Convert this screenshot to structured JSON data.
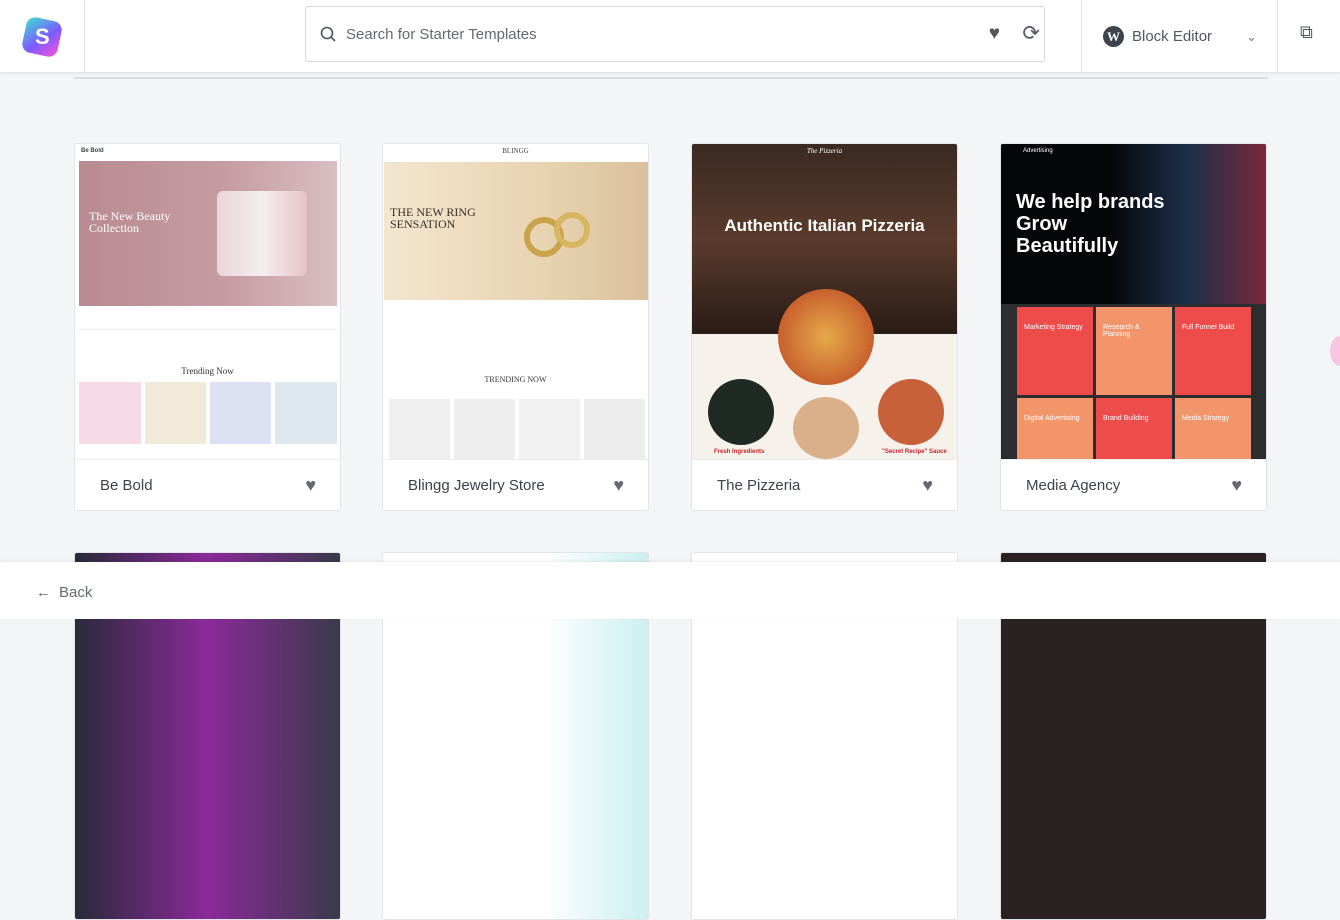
{
  "header": {
    "search_placeholder": "Search for Starter Templates",
    "editor_label": "Block Editor",
    "logo_letter": "S"
  },
  "icons": {
    "search": "search-icon",
    "favorite": "heart-icon",
    "sync": "sync-icon",
    "wordpress": "wordpress-icon",
    "chevron": "chevron-down-icon",
    "external": "external-link-icon",
    "back": "arrow-left-icon"
  },
  "templates": [
    {
      "name": "Be Bold",
      "brand": "Be Bold",
      "hero": "The New Beauty Collection",
      "section": "Trending Now"
    },
    {
      "name": "Blingg Jewelry Store",
      "brand": "BLINGG",
      "hero": "THE NEW RING SENSATION",
      "section": "TRENDING NOW"
    },
    {
      "name": "The Pizzeria",
      "brand": "The Pizzeria",
      "hero": "Authentic Italian Pizzeria",
      "captions": [
        "Fresh Ingredients",
        "\"Secret Recipe\" Sauce"
      ]
    },
    {
      "name": "Media Agency",
      "brand": "Advertising",
      "hero": "We help brands Grow Beautifully",
      "tiles": [
        "Marketing Strategy",
        "Research & Planning",
        "Full Funnel Build",
        "Digital Advertising",
        "Brand Building",
        "Media Strategy"
      ]
    }
  ],
  "footer": {
    "back_label": "Back"
  }
}
